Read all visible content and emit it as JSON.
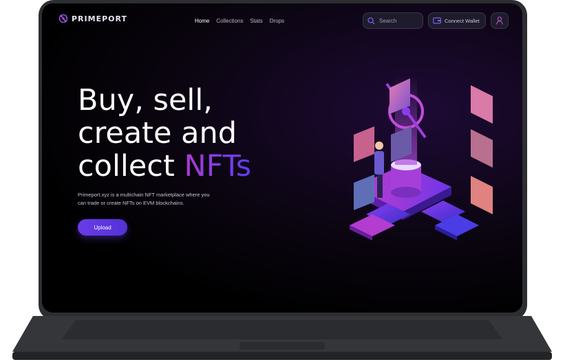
{
  "brand": {
    "name": "PRIMEPORT",
    "accent": "#7b3ff0",
    "gradient_start": "#b03bd6",
    "gradient_end": "#5a3df0"
  },
  "nav": {
    "links": [
      {
        "label": "Home",
        "active": true
      },
      {
        "label": "Collections",
        "active": false
      },
      {
        "label": "Stats",
        "active": false
      },
      {
        "label": "Drops",
        "active": false
      }
    ],
    "search_label": "Search",
    "connect_wallet_label": "Connect Wallet"
  },
  "hero": {
    "title_line1": "Buy, sell,",
    "title_line2": "create and",
    "title_line3_prefix": "collect ",
    "title_line3_highlight": "NFTs",
    "description": "Primeport.xyz is a multichain NFT marketplace where you can trade or create NFTs on EVM blockchains.",
    "upload_label": "Upload"
  },
  "icons": [
    "logo-icon",
    "search-icon",
    "wallet-icon",
    "user-icon"
  ]
}
